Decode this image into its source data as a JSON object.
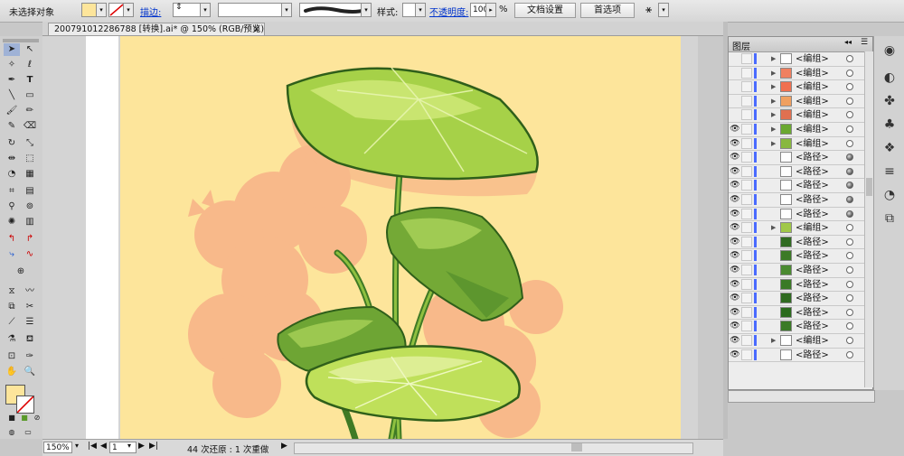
{
  "control_bar": {
    "selection_label": "未选择对象",
    "stroke_label": "描边:",
    "brush_placeholder": "",
    "style_label": "样式:",
    "opacity_label": "不透明度:",
    "opacity_value": "100",
    "opacity_unit": "%",
    "doc_settings_button": "文档设置",
    "preferences_button": "首选项",
    "fill_color": "#fde59b"
  },
  "document_tab": {
    "title": "200791012286788 [转换].ai* @ 150% (RGB/预览)",
    "close_glyph": "×"
  },
  "status_bar": {
    "zoom": "150%",
    "page": "1",
    "history": "44 次还原 : 1 次重做"
  },
  "layers_panel": {
    "title": "图层",
    "rows": [
      {
        "name": "<编组>",
        "visible": false,
        "expandable": true,
        "thumb": "#ffffff",
        "target": "hollow"
      },
      {
        "name": "<编组>",
        "visible": false,
        "expandable": true,
        "thumb": "#f08060",
        "target": "hollow"
      },
      {
        "name": "<编组>",
        "visible": false,
        "expandable": true,
        "thumb": "#f07050",
        "target": "hollow"
      },
      {
        "name": "<编组>",
        "visible": false,
        "expandable": true,
        "thumb": "#f0a060",
        "target": "hollow"
      },
      {
        "name": "<编组>",
        "visible": false,
        "expandable": true,
        "thumb": "#e07050",
        "target": "hollow"
      },
      {
        "name": "<编组>",
        "visible": true,
        "expandable": true,
        "thumb": "#6aa830",
        "target": "hollow"
      },
      {
        "name": "<编组>",
        "visible": true,
        "expandable": true,
        "thumb": "#88b840",
        "target": "hollow"
      },
      {
        "name": "<路径>",
        "visible": true,
        "expandable": false,
        "thumb": "#ffffff",
        "target": "filled"
      },
      {
        "name": "<路径>",
        "visible": true,
        "expandable": false,
        "thumb": "#ffffff",
        "target": "filled"
      },
      {
        "name": "<路径>",
        "visible": true,
        "expandable": false,
        "thumb": "#ffffff",
        "target": "filled"
      },
      {
        "name": "<路径>",
        "visible": true,
        "expandable": false,
        "thumb": "#ffffff",
        "target": "filled"
      },
      {
        "name": "<路径>",
        "visible": true,
        "expandable": false,
        "thumb": "#ffffff",
        "target": "filled"
      },
      {
        "name": "<编组>",
        "visible": true,
        "expandable": true,
        "thumb": "#a0c848",
        "target": "hollow"
      },
      {
        "name": "<路径>",
        "visible": true,
        "expandable": false,
        "thumb": "#2f6a20",
        "target": "hollow"
      },
      {
        "name": "<路径>",
        "visible": true,
        "expandable": false,
        "thumb": "#3c7a26",
        "target": "hollow"
      },
      {
        "name": "<路径>",
        "visible": true,
        "expandable": false,
        "thumb": "#4a8a30",
        "target": "hollow"
      },
      {
        "name": "<路径>",
        "visible": true,
        "expandable": false,
        "thumb": "#3a7a26",
        "target": "hollow"
      },
      {
        "name": "<路径>",
        "visible": true,
        "expandable": false,
        "thumb": "#2f6a20",
        "target": "hollow"
      },
      {
        "name": "<路径>",
        "visible": true,
        "expandable": false,
        "thumb": "#2a6a1c",
        "target": "hollow"
      },
      {
        "name": "<路径>",
        "visible": true,
        "expandable": false,
        "thumb": "#3a7a26",
        "target": "hollow"
      },
      {
        "name": "<编组>",
        "visible": true,
        "expandable": true,
        "thumb": "#ffffff",
        "target": "hollow"
      },
      {
        "name": "<路径>",
        "visible": true,
        "expandable": false,
        "thumb": "#ffffff",
        "target": "hollow"
      }
    ]
  },
  "colors": {
    "artboard": "#fde59b",
    "shadow_flower": "#f8b98a",
    "leaf_light": "#c5e060",
    "leaf_mid": "#8fc040",
    "leaf_dark": "#3f7a25",
    "selection_blue": "#4a6bff"
  }
}
